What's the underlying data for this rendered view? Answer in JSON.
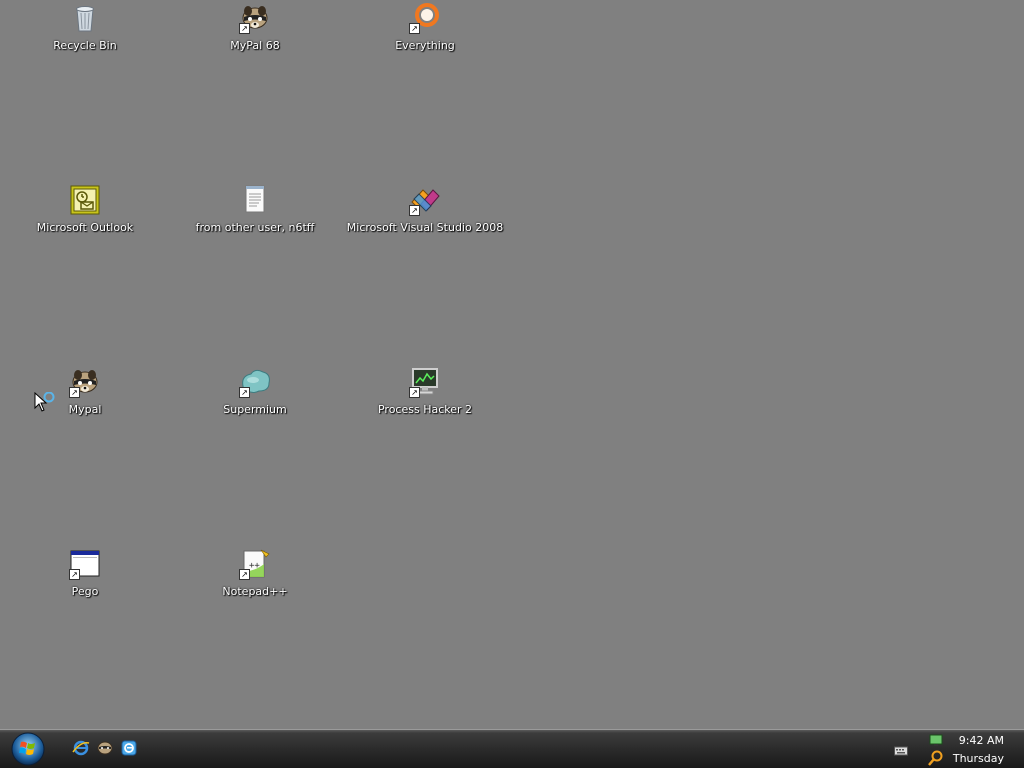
{
  "desktop": {
    "background": "#808080",
    "icons": [
      {
        "label": "Recycle Bin",
        "icon": "recycle-bin-icon",
        "shortcut": false
      },
      {
        "label": "MyPal 68",
        "icon": "raccoon-icon",
        "shortcut": true
      },
      {
        "label": "Everything",
        "icon": "everything-search-icon",
        "shortcut": true
      },
      {
        "label": "Microsoft Outlook",
        "icon": "outlook-icon",
        "shortcut": false
      },
      {
        "label": "from other user, n6tff",
        "icon": "text-document-icon",
        "shortcut": false
      },
      {
        "label": "Microsoft Visual Studio 2008",
        "icon": "visual-studio-icon",
        "shortcut": true
      },
      {
        "label": "Mypal",
        "icon": "raccoon-icon",
        "shortcut": true
      },
      {
        "label": "Supermium",
        "icon": "supermium-icon",
        "shortcut": true
      },
      {
        "label": "Process Hacker 2",
        "icon": "process-hacker-icon",
        "shortcut": true
      },
      {
        "label": "Pego",
        "icon": "window-app-icon",
        "shortcut": true
      },
      {
        "label": "Notepad++",
        "icon": "notepad-plus-plus-icon",
        "shortcut": true
      }
    ]
  },
  "taskbar": {
    "start_button": "start-orb-icon",
    "quick_launch": [
      "internet-explorer-icon",
      "raccoon-icon",
      "browser-icon"
    ],
    "tray": {
      "keyboard_icon": "keyboard-icon",
      "network_icon": "network-icon",
      "search_icon": "search-icon",
      "time": "9:42 AM",
      "day": "Thursday"
    }
  }
}
